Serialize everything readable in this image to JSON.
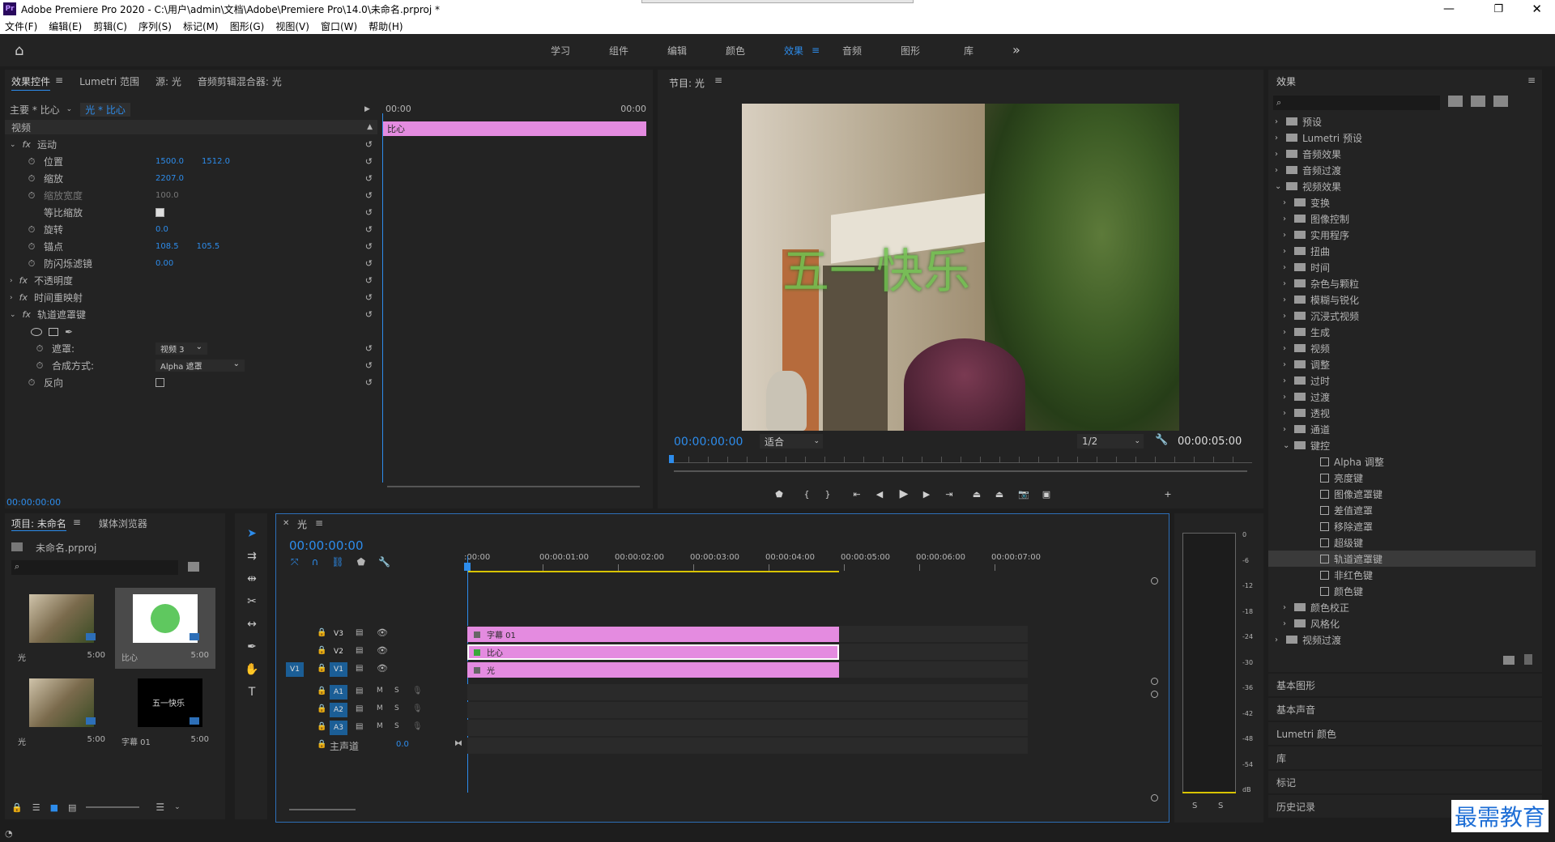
{
  "window": {
    "title": "Adobe Premiere Pro 2020 - C:\\用户\\admin\\文档\\Adobe\\Premiere Pro\\14.0\\未命名.prproj *",
    "logo": "Pr"
  },
  "menu": [
    "文件(F)",
    "编辑(E)",
    "剪辑(C)",
    "序列(S)",
    "标记(M)",
    "图形(G)",
    "视图(V)",
    "窗口(W)",
    "帮助(H)"
  ],
  "workspaces": [
    "学习",
    "组件",
    "编辑",
    "颜色",
    "效果",
    "音频",
    "图形",
    "库"
  ],
  "active_workspace": "效果",
  "effect_controls": {
    "tabs": [
      "效果控件",
      "Lumetri 范围",
      "源: 光",
      "音频剪辑混合器: 光"
    ],
    "master": "主要 * 比心",
    "clip": "光 * 比心",
    "section": "视频",
    "timecode_start": "00:00",
    "timecode_end": "00:00",
    "clip_label": "比心",
    "rows": [
      {
        "label": "运动",
        "fx": true
      },
      {
        "label": "位置",
        "v1": "1500.0",
        "v2": "1512.0"
      },
      {
        "label": "缩放",
        "v1": "2207.0"
      },
      {
        "label": "缩放宽度",
        "v1": "100.0",
        "dim": true
      },
      {
        "label": "等比缩放",
        "checkbox": true
      },
      {
        "label": "旋转",
        "v1": "0.0"
      },
      {
        "label": "锚点",
        "v1": "108.5",
        "v2": "105.5"
      },
      {
        "label": "防闪烁滤镜",
        "v1": "0.00"
      },
      {
        "label": "不透明度",
        "fx": true
      },
      {
        "label": "时间重映射",
        "fx": true
      },
      {
        "label": "轨道遮罩键",
        "fx": true
      },
      {
        "label": "遮罩:",
        "select": "视频 3"
      },
      {
        "label": "合成方式:",
        "select": "Alpha 遮罩"
      },
      {
        "label": "反向",
        "checkbox": true
      }
    ],
    "footer_time": "00:00:00:00"
  },
  "program": {
    "title": "节目: 光",
    "overlay_text": "五一快乐",
    "timecode": "00:00:00:00",
    "fit": "适合",
    "res": "1/2",
    "duration": "00:00:05:00"
  },
  "effects": {
    "title": "效果",
    "tree": [
      {
        "l": "预设",
        "d": 0
      },
      {
        "l": "Lumetri 预设",
        "d": 0
      },
      {
        "l": "音频效果",
        "d": 0
      },
      {
        "l": "音频过渡",
        "d": 0
      },
      {
        "l": "视频效果",
        "d": 0,
        "open": true
      },
      {
        "l": "变换",
        "d": 1
      },
      {
        "l": "图像控制",
        "d": 1
      },
      {
        "l": "实用程序",
        "d": 1
      },
      {
        "l": "扭曲",
        "d": 1
      },
      {
        "l": "时间",
        "d": 1
      },
      {
        "l": "杂色与颗粒",
        "d": 1
      },
      {
        "l": "模糊与锐化",
        "d": 1
      },
      {
        "l": "沉浸式视频",
        "d": 1
      },
      {
        "l": "生成",
        "d": 1
      },
      {
        "l": "视频",
        "d": 1
      },
      {
        "l": "调整",
        "d": 1
      },
      {
        "l": "过时",
        "d": 1
      },
      {
        "l": "过渡",
        "d": 1
      },
      {
        "l": "透视",
        "d": 1
      },
      {
        "l": "通道",
        "d": 1
      },
      {
        "l": "键控",
        "d": 1,
        "open": true
      },
      {
        "l": "Alpha 调整",
        "d": 2
      },
      {
        "l": "亮度键",
        "d": 2
      },
      {
        "l": "图像遮罩键",
        "d": 2
      },
      {
        "l": "差值遮罩",
        "d": 2
      },
      {
        "l": "移除遮罩",
        "d": 2
      },
      {
        "l": "超级键",
        "d": 2
      },
      {
        "l": "轨道遮罩键",
        "d": 2,
        "sel": true
      },
      {
        "l": "非红色键",
        "d": 2
      },
      {
        "l": "颜色键",
        "d": 2
      },
      {
        "l": "颜色校正",
        "d": 1
      },
      {
        "l": "风格化",
        "d": 1
      },
      {
        "l": "视频过渡",
        "d": 0
      }
    ],
    "panels": [
      "基本图形",
      "基本声音",
      "Lumetri 颜色",
      "库",
      "标记",
      "历史记录"
    ]
  },
  "project": {
    "tabs": [
      "项目: 未命名",
      "媒体浏览器"
    ],
    "file": "未命名.prproj",
    "items": [
      {
        "name": "光",
        "dur": "5:00"
      },
      {
        "name": "比心",
        "dur": "5:00"
      },
      {
        "name": "光",
        "dur": "5:00"
      },
      {
        "name": "字幕 01",
        "dur": "5:00",
        "caption": "五一快乐"
      }
    ]
  },
  "timeline": {
    "title": "光",
    "timecode": "00:00:00:00",
    "ruler": [
      ":00:00",
      "00:00:01:00",
      "00:00:02:00",
      "00:00:03:00",
      "00:00:04:00",
      "00:00:05:00",
      "00:00:06:00",
      "00:00:07:00"
    ],
    "video_tracks": [
      {
        "id": "V3",
        "clip": "字幕 01"
      },
      {
        "id": "V2",
        "clip": "比心"
      },
      {
        "id": "V1",
        "clip": "光",
        "src": "V1"
      }
    ],
    "audio_tracks": [
      "A1",
      "A2",
      "A3"
    ],
    "master": "主声道",
    "master_val": "0.0"
  },
  "meter": {
    "scale": [
      "0",
      "-6",
      "-12",
      "-18",
      "-24",
      "-30",
      "-36",
      "-42",
      "-48",
      "-54",
      "dB"
    ],
    "s": "S"
  },
  "watermark": "最需教育",
  "colors": {
    "accent": "#2d8ceb",
    "clip": "#e48be0",
    "track_btn": "#1b5e96"
  }
}
